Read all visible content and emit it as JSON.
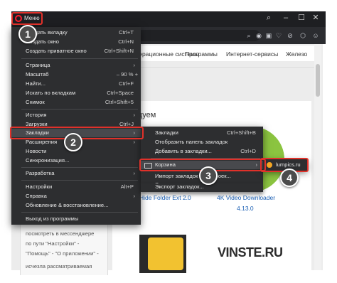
{
  "window": {
    "menu_button_label": "Меню"
  },
  "page": {
    "nav_links": [
      "Операционные системы",
      "Программы",
      "Интернет-сервисы",
      "Железо"
    ],
    "heading": "Рекомендуем",
    "tile1_caption": "Hide Folder Ext 2.0",
    "tile2_caption": "4K Video Downloader",
    "tile2_version": "4.13.0",
    "banner_text": "VINSTE.RU",
    "left_text": [
      "посмотреть в мессенджере",
      "по пути \"Настройки\" -",
      "\"Помощь\" - \"О приложении\" -",
      "исчезла рассматриваемая"
    ]
  },
  "main_menu": {
    "items": [
      {
        "label": "Создать вкладку",
        "shortcut": "Ctrl+T"
      },
      {
        "label": "Создать окно",
        "shortcut": "Ctrl+N"
      },
      {
        "label": "Создать приватное окно",
        "shortcut": "Ctrl+Shift+N"
      },
      {
        "label": "Страница",
        "shortcut": ""
      },
      {
        "label": "Масштаб",
        "shortcut": "–  90 %  +"
      },
      {
        "label": "Найти...",
        "shortcut": "Ctrl+F"
      },
      {
        "label": "Искать по вкладкам",
        "shortcut": "Ctrl+Space"
      },
      {
        "label": "Снимок",
        "shortcut": "Ctrl+Shift+5"
      },
      {
        "label": "История",
        "shortcut": ""
      },
      {
        "label": "Загрузки",
        "shortcut": "Ctrl+J"
      },
      {
        "label": "Закладки",
        "shortcut": ""
      },
      {
        "label": "Расширения",
        "shortcut": ""
      },
      {
        "label": "Новости",
        "shortcut": ""
      },
      {
        "label": "Синхронизация...",
        "shortcut": ""
      },
      {
        "label": "Разработка",
        "shortcut": ""
      },
      {
        "label": "Настройки",
        "shortcut": "Alt+P"
      },
      {
        "label": "Справка",
        "shortcut": ""
      },
      {
        "label": "Обновление & восстановление...",
        "shortcut": ""
      },
      {
        "label": "Выход из программы",
        "shortcut": ""
      }
    ]
  },
  "bookmarks_menu": {
    "items": [
      {
        "label": "Закладки",
        "shortcut": "Ctrl+Shift+B"
      },
      {
        "label": "Отобразить панель закладок",
        "shortcut": ""
      },
      {
        "label": "Добавить в закладки...",
        "shortcut": "Ctrl+D"
      },
      {
        "label": "Корзина",
        "shortcut": ""
      },
      {
        "label": "Импорт закладок и настроек...",
        "shortcut": ""
      },
      {
        "label": "Экспорт закладок...",
        "shortcut": ""
      }
    ]
  },
  "trash_menu": {
    "items": [
      {
        "label": "lumpics.ru"
      }
    ]
  },
  "step_badges": [
    "1",
    "2",
    "3",
    "4"
  ],
  "colors": {
    "highlight": "#e0312a",
    "menu_bg": "#2d2e30",
    "badge_bg": "#4c4c4c"
  }
}
